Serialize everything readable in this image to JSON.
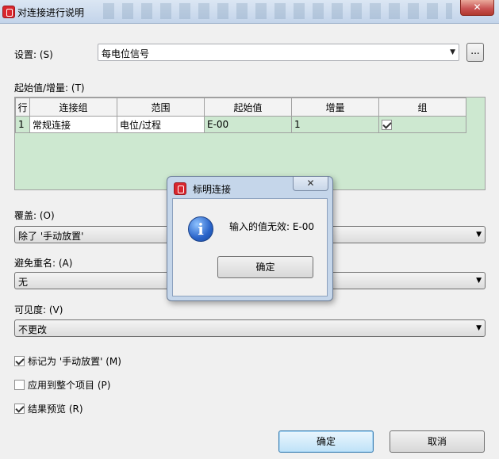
{
  "window": {
    "title": "对连接进行说明",
    "close_glyph": "✕"
  },
  "settings": {
    "label": "设置: (S)",
    "value": "每电位信号",
    "more_label": "..."
  },
  "start_increment": {
    "label": "起始值/增量: (T)",
    "columns": [
      "行",
      "连接组",
      "范围",
      "起始值",
      "增量",
      "组"
    ],
    "rows": [
      {
        "row": "1",
        "group": "常规连接",
        "scope": "电位/过程",
        "start": "E-00",
        "increment": "1",
        "grouped": true
      }
    ]
  },
  "overwrite": {
    "label": "覆盖: (O)",
    "value": "除了 '手动放置'"
  },
  "avoid_duplicate": {
    "label": "避免重名: (A)",
    "value": "无"
  },
  "visibility": {
    "label": "可见度: (V)",
    "value": "不更改"
  },
  "checkboxes": [
    {
      "label": "标记为 '手动放置' (M)",
      "checked": true
    },
    {
      "label": "应用到整个项目 (P)",
      "checked": false
    },
    {
      "label": "结果预览 (R)",
      "checked": true
    }
  ],
  "buttons": {
    "ok": "确定",
    "cancel": "取消"
  },
  "message_box": {
    "title": "标明连接",
    "message": "输入的值无效: E-00",
    "ok": "确定",
    "close_glyph": "✕"
  },
  "colors": {
    "grid_background": "#cde8d0",
    "close_button": "#c75050",
    "accent": "#3c7fb1"
  }
}
